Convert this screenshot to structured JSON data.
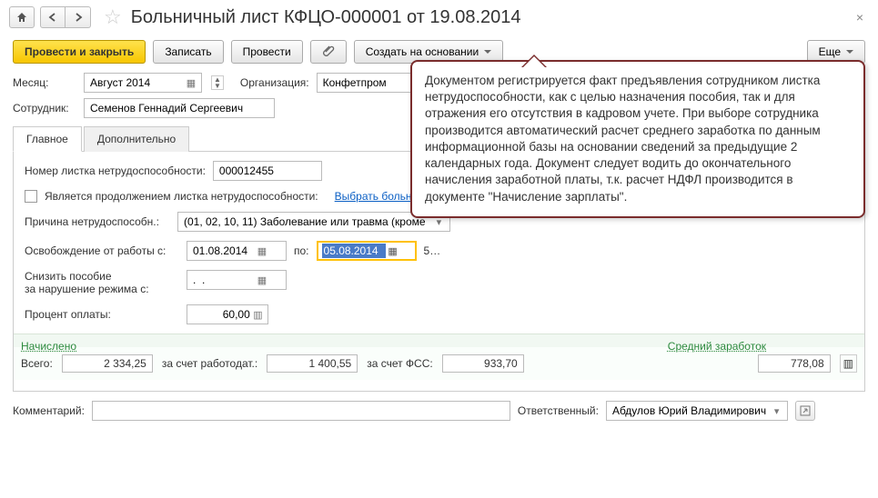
{
  "header": {
    "title": "Больничный лист КФЦО-000001 от 19.08.2014"
  },
  "actions": {
    "post_close": "Провести и закрыть",
    "save": "Записать",
    "post": "Провести",
    "create_based": "Создать на основании",
    "more": "Еще"
  },
  "form": {
    "month_label": "Месяц:",
    "month_value": "Август 2014",
    "org_label": "Организация:",
    "org_value": "Конфетпром",
    "employee_label": "Сотрудник:",
    "employee_value": "Семенов Геннадий Сергеевич"
  },
  "tabs": {
    "main": "Главное",
    "additional": "Дополнительно"
  },
  "main_tab": {
    "sheet_no_label": "Номер листка нетрудоспособности:",
    "sheet_no_value": "000012455",
    "is_continuation_label": "Является продолжением листка нетрудоспособности:",
    "choose_sheet_link": "Выбрать больничный лист",
    "reason_label": "Причина нетрудоспособн.:",
    "reason_value": "(01, 02, 10, 11) Заболевание или травма (кроме",
    "exempt_label": "Освобождение от работы с:",
    "date_from": "01.08.2014",
    "date_to_label": "по:",
    "date_to": "05.08.2014",
    "days": "5…",
    "reduce_label1": "Снизить пособие",
    "reduce_label2": "за нарушение режима с:",
    "reduce_value": ".  .",
    "percent_label": "Процент оплаты:",
    "percent_value": "60,00"
  },
  "results": {
    "accrued": "Начислено",
    "avg_earnings": "Средний заработок",
    "total_label": "Всего:",
    "total_value": "2 334,25",
    "employer_label": "за счет работодат.:",
    "employer_value": "1 400,55",
    "fss_label": "за счет ФСС:",
    "fss_value": "933,70",
    "avg_value": "778,08"
  },
  "footer": {
    "comment_label": "Комментарий:",
    "responsible_label": "Ответственный:",
    "responsible_value": "Абдулов Юрий Владимирович"
  },
  "callout": {
    "text": "Документом регистрируется факт предъявления сотрудником листка нетрудоспособности, как с целью назначения пособия, так и для отражения его отсутствия в кадровом учете. При выборе сотрудника производится автоматический расчет среднего заработка по данным информационной базы на основании сведений за предыдущие 2 календарных года. Документ следует водить до окончательного начисления заработной платы, т.к. расчет НДФЛ производится в документе \"Начисление зарплаты\"."
  }
}
